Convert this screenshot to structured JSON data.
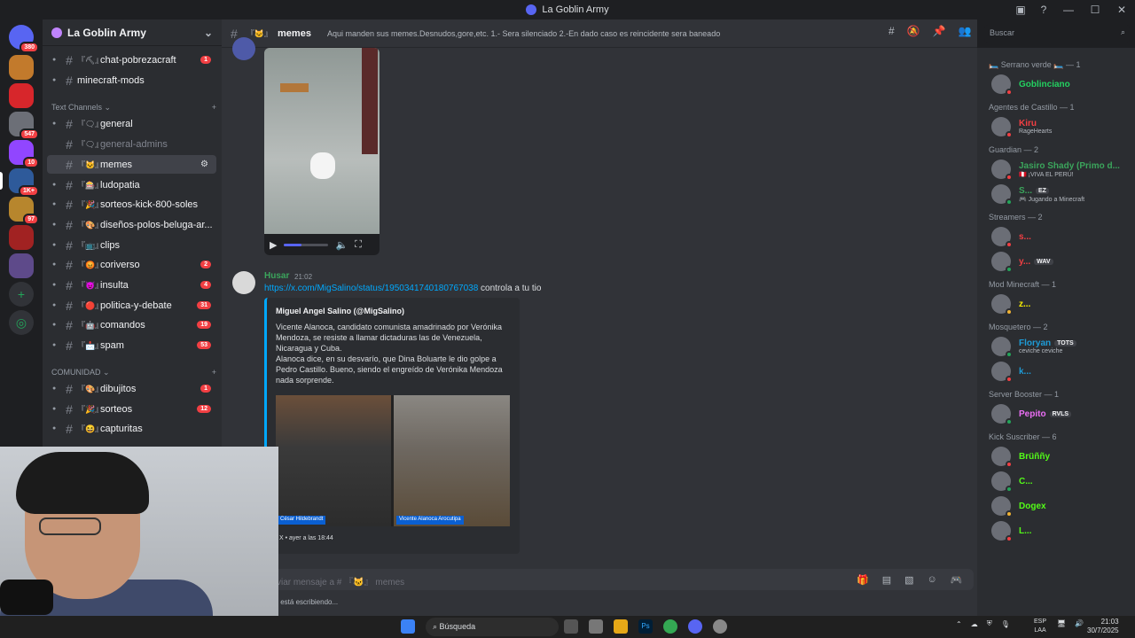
{
  "window": {
    "title": "La Goblin Army"
  },
  "guild_badges": [
    "380",
    "547",
    "10",
    "1K+",
    "97"
  ],
  "server": {
    "name": "La Goblin Army"
  },
  "channels_top": [
    {
      "emoji": "『⛏』",
      "name": "chat-pobrezacraft",
      "badge": "1"
    },
    {
      "emoji": "",
      "name": "minecraft-mods",
      "badge": ""
    }
  ],
  "categories": {
    "text": "Text Channels",
    "community": "COMUNIDAD"
  },
  "channels_text": [
    {
      "emoji": "『🗨』",
      "name": "general",
      "badge": ""
    },
    {
      "emoji": "『🗨』",
      "name": "general-admins",
      "badge": ""
    },
    {
      "emoji": "『🐱』",
      "name": "memes",
      "badge": ""
    },
    {
      "emoji": "『🎰』",
      "name": "ludopatia",
      "badge": ""
    },
    {
      "emoji": "『🎉』",
      "name": "sorteos-kick-800-soles",
      "badge": ""
    },
    {
      "emoji": "『🎨』",
      "name": "diseños-polos-beluga-ar...",
      "badge": ""
    },
    {
      "emoji": "『📺』",
      "name": "clips",
      "badge": ""
    },
    {
      "emoji": "『😡』",
      "name": "coriverso",
      "badge": "2"
    },
    {
      "emoji": "『😈』",
      "name": "insulta",
      "badge": "4"
    },
    {
      "emoji": "『🔴』",
      "name": "politica-y-debate",
      "badge": "31"
    },
    {
      "emoji": "『🤖』",
      "name": "comandos",
      "badge": "19"
    },
    {
      "emoji": "『📩』",
      "name": "spam",
      "badge": "53"
    }
  ],
  "channels_community": [
    {
      "emoji": "『🎨』",
      "name": "dibujitos",
      "badge": "1"
    },
    {
      "emoji": "『🎉』",
      "name": "sorteos",
      "badge": "12"
    },
    {
      "emoji": "『😆』",
      "name": "capturitas",
      "badge": ""
    }
  ],
  "chat_header": {
    "emoji": "『🐱』",
    "name": "memes",
    "topic": "Aqui manden sus memes.Desnudos,gore,etc. 1.- Sera silenciado 2.-En dado caso es reincidente sera baneado"
  },
  "search": {
    "placeholder": "Buscar"
  },
  "video": {
    "progress": 0.4
  },
  "message": {
    "author": "Husar",
    "time": "21:02",
    "link": "https://x.com/MigSalino/status/1950341740180767038",
    "text": " controla a tu tio"
  },
  "embed": {
    "author": "Miguel Angel Salino (@MigSalino)",
    "desc_1": "Vicente Alanoca, candidato comunista amadrinado por Verónika Mendoza, se resiste a llamar dictaduras las de Venezuela, Nicaragua y Cuba.",
    "desc_2": "Alanoca dice, en su desvarío, que Dina Boluarte le dio golpe a Pedro Castillo. Bueno, siendo el engreído de Verónika Mendoza nada sorprende.",
    "label_left": "César Hildebrandt",
    "label_right": "Vicente Alanoca Arocutipa",
    "footer": "X • ayer a las 18:44"
  },
  "composer": {
    "placeholder": "viar mensaje a # 『🐱』 memes"
  },
  "typing": "RO está escribiendo...",
  "members": [
    {
      "category": "🛏️ Serrano verde 🛏️ — 1",
      "users": [
        {
          "name": "Goblinciano",
          "sub": "",
          "tag": "",
          "color": "#23d160",
          "status": "#f23f43"
        }
      ]
    },
    {
      "category": "Agentes de Castillo — 1",
      "users": [
        {
          "name": "Kiru",
          "sub": "RageHearts",
          "tag": "",
          "color": "#f23f43",
          "status": "#f23f43"
        }
      ]
    },
    {
      "category": "Guardian — 2",
      "users": [
        {
          "name": "Jasiro Shady (Primo d...",
          "sub": "🇵🇪 ¡VIVA EL PERÚ!",
          "tag": "",
          "color": "#3ba55c",
          "status": "#f23f43"
        },
        {
          "name": "S...",
          "sub": "🎮 Jugando a Minecraft",
          "tag": "EZ",
          "color": "#3ba55c",
          "status": "#23a55a"
        }
      ]
    },
    {
      "category": "Streamers — 2",
      "users": [
        {
          "name": "s...",
          "sub": "",
          "tag": "",
          "color": "#f23f43",
          "status": "#f23f43"
        },
        {
          "name": "y...",
          "sub": "",
          "tag": "WAV",
          "color": "#f23f43",
          "status": "#23a55a"
        }
      ]
    },
    {
      "category": "Mod Minecraft — 1",
      "users": [
        {
          "name": "z...",
          "sub": "",
          "tag": "",
          "color": "#faf000",
          "status": "#f0b232"
        }
      ]
    },
    {
      "category": "Mosquetero — 2",
      "users": [
        {
          "name": "Floryan",
          "sub": "ceviche ceviche",
          "tag": "TOTS",
          "color": "#1e9bd6",
          "status": "#23a55a"
        },
        {
          "name": "k...",
          "sub": "",
          "tag": "",
          "color": "#1e9bd6",
          "status": "#f23f43"
        }
      ]
    },
    {
      "category": "Server Booster — 1",
      "users": [
        {
          "name": "Pepito",
          "sub": "",
          "tag": "RVLS",
          "color": "#eb6ef5",
          "status": "#23a55a"
        }
      ]
    },
    {
      "category": "Kick Suscriber — 6",
      "users": [
        {
          "name": "Brüññy",
          "sub": "",
          "tag": "",
          "color": "#53fc18",
          "status": "#f23f43"
        },
        {
          "name": "C...",
          "sub": "",
          "tag": "",
          "color": "#53fc18",
          "status": "#23a55a"
        },
        {
          "name": "Dogex",
          "sub": "",
          "tag": "",
          "color": "#53fc18",
          "status": "#f0b232"
        },
        {
          "name": "L...",
          "sub": "",
          "tag": "",
          "color": "#53fc18",
          "status": "#f23f43"
        }
      ]
    }
  ],
  "taskbar": {
    "search": "Búsqueda",
    "lang": "ESP",
    "lang2": "LAA",
    "time": "21:03",
    "date": "30/7/2025"
  }
}
